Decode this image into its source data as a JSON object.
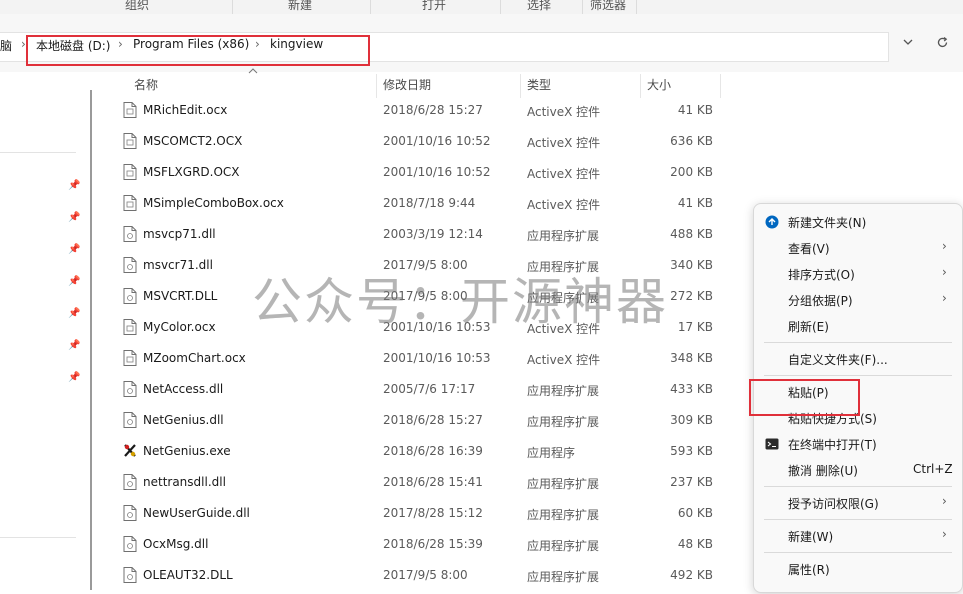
{
  "toolbar": {
    "organize": "组织",
    "new": "新建",
    "open": "打开",
    "select": "选择",
    "filter": "筛选器"
  },
  "address": {
    "crumbs": [
      "脑",
      "本地磁盘 (D:)",
      "Program Files (x86)",
      "kingview"
    ],
    "separator": "›",
    "dropdown_icon": "chevron-down-icon",
    "refresh_icon": "refresh-icon"
  },
  "columns": {
    "name": "名称",
    "date": "修改日期",
    "type": "类型",
    "size": "大小"
  },
  "files": [
    {
      "name": "MRichEdit.ocx",
      "date": "2018/6/28 15:27",
      "type": "ActiveX 控件",
      "size": "41 KB",
      "icon": "file-icon"
    },
    {
      "name": "MSCOMCT2.OCX",
      "date": "2001/10/16 10:52",
      "type": "ActiveX 控件",
      "size": "636 KB",
      "icon": "file-icon"
    },
    {
      "name": "MSFLXGRD.OCX",
      "date": "2001/10/16 10:52",
      "type": "ActiveX 控件",
      "size": "200 KB",
      "icon": "file-icon"
    },
    {
      "name": "MSimpleComboBox.ocx",
      "date": "2018/7/18 9:44",
      "type": "ActiveX 控件",
      "size": "41 KB",
      "icon": "file-icon"
    },
    {
      "name": "msvcp71.dll",
      "date": "2003/3/19 12:14",
      "type": "应用程序扩展",
      "size": "488 KB",
      "icon": "file-icon"
    },
    {
      "name": "msvcr71.dll",
      "date": "2017/9/5 8:00",
      "type": "应用程序扩展",
      "size": "340 KB",
      "icon": "file-icon"
    },
    {
      "name": "MSVCRT.DLL",
      "date": "2017/9/5 8:00",
      "type": "应用程序扩展",
      "size": "272 KB",
      "icon": "file-icon"
    },
    {
      "name": "MyColor.ocx",
      "date": "2001/10/16 10:53",
      "type": "ActiveX 控件",
      "size": "17 KB",
      "icon": "file-icon"
    },
    {
      "name": "MZoomChart.ocx",
      "date": "2001/10/16 10:53",
      "type": "ActiveX 控件",
      "size": "348 KB",
      "icon": "file-icon"
    },
    {
      "name": "NetAccess.dll",
      "date": "2005/7/6 17:17",
      "type": "应用程序扩展",
      "size": "433 KB",
      "icon": "file-icon"
    },
    {
      "name": "NetGenius.dll",
      "date": "2018/6/28 15:27",
      "type": "应用程序扩展",
      "size": "309 KB",
      "icon": "file-icon"
    },
    {
      "name": "NetGenius.exe",
      "date": "2018/6/28 16:39",
      "type": "应用程序",
      "size": "593 KB",
      "icon": "exe-icon"
    },
    {
      "name": "nettransdll.dll",
      "date": "2018/6/28 15:41",
      "type": "应用程序扩展",
      "size": "237 KB",
      "icon": "file-icon"
    },
    {
      "name": "NewUserGuide.dll",
      "date": "2017/8/28 15:12",
      "type": "应用程序扩展",
      "size": "60 KB",
      "icon": "file-icon"
    },
    {
      "name": "OcxMsg.dll",
      "date": "2018/6/28 15:39",
      "type": "应用程序扩展",
      "size": "48 KB",
      "icon": "file-icon"
    },
    {
      "name": "OLEAUT32.DLL",
      "date": "2017/9/5 8:00",
      "type": "应用程序扩展",
      "size": "492 KB",
      "icon": "file-icon"
    }
  ],
  "watermark": "公众号：开源神器",
  "context_menu": {
    "new_folder": "新建文件夹(N)",
    "view": "查看(V)",
    "sort_by": "排序方式(O)",
    "group_by": "分组依据(P)",
    "refresh": "刷新(E)",
    "customize_folder": "自定义文件夹(F)...",
    "paste": "粘贴(P)",
    "paste_shortcut": "粘贴快捷方式(S)",
    "open_in_terminal": "在终端中打开(T)",
    "undo_delete": "撤消 删除(U)",
    "undo_shortcut": "Ctrl+Z",
    "give_access": "授予访问权限(G)",
    "new": "新建(W)",
    "properties": "属性(R)",
    "submenu_arrow": "›"
  },
  "colors": {
    "highlight_box": "#e0303a",
    "menu_background": "#f9f9f9",
    "accent": "#0067c0"
  }
}
